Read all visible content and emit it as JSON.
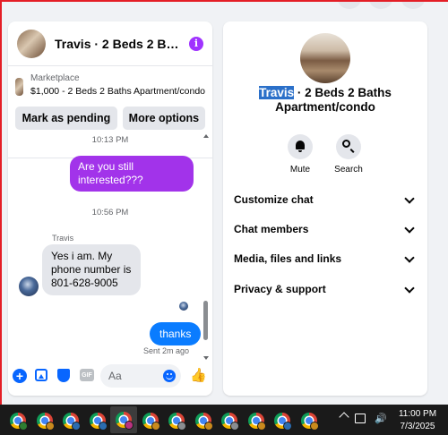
{
  "chat": {
    "header_title": "Travis · 2 Beds 2 Baths Apartment/condo",
    "info_glyph": "i",
    "marketplace_label": "Marketplace",
    "listing_text": "$1,000 - 2 Beds 2 Baths Apartment/condo",
    "mark_pending_label": "Mark as pending",
    "more_options_label": "More options"
  },
  "messages": [
    {
      "type": "timestamp",
      "text": "10:13 PM"
    },
    {
      "type": "outgoing",
      "text": "Are you still interested???"
    },
    {
      "type": "timestamp",
      "text": "10:56 PM"
    },
    {
      "type": "sender",
      "text": "Travis"
    },
    {
      "type": "incoming",
      "text": "Yes i am. My phone number is 801-628-9005"
    },
    {
      "type": "outgoing",
      "text": "thanks"
    },
    {
      "type": "status",
      "text": "Sent 2m ago"
    }
  ],
  "composer": {
    "placeholder": "Aa",
    "gif_label": "GIF",
    "like_glyph": "👍",
    "plus_glyph": "+"
  },
  "info_panel": {
    "title_highlight": "Travis",
    "title_rest": " · 2 Beds 2 Baths Apartment/condo",
    "actions": [
      {
        "label": "Mute",
        "icon": "bell-icon"
      },
      {
        "label": "Search",
        "icon": "search-icon"
      }
    ],
    "menu": [
      {
        "label": "Customize chat"
      },
      {
        "label": "Chat members"
      },
      {
        "label": "Media, files and links"
      },
      {
        "label": "Privacy & support"
      }
    ]
  },
  "taskbar": {
    "time": "11:00 PM",
    "date": "7/3/2025",
    "volume_glyph": "🔊",
    "apps": [
      {
        "icon": "chrome-icon",
        "badge": "#2e7d32",
        "badge_text": "M"
      },
      {
        "icon": "chrome-icon",
        "badge": "#c98a1d"
      },
      {
        "icon": "chrome-icon",
        "badge": "#2b6cb0"
      },
      {
        "icon": "chrome-icon",
        "badge": "#2b6cb0"
      },
      {
        "icon": "chrome-icon",
        "badge": "#b83280",
        "active": true
      },
      {
        "icon": "chrome-icon",
        "badge": "#c98a1d"
      },
      {
        "icon": "chrome-icon",
        "badge": "#8a8d91"
      },
      {
        "icon": "chrome-icon",
        "badge": "#c98a1d"
      },
      {
        "icon": "chrome-icon",
        "badge": "#8a8d91"
      },
      {
        "icon": "chrome-icon",
        "badge": "#c98a1d"
      },
      {
        "icon": "chrome-icon",
        "badge": "#2b6cb0"
      },
      {
        "icon": "chrome-icon",
        "badge": "#c98a1d"
      }
    ]
  }
}
